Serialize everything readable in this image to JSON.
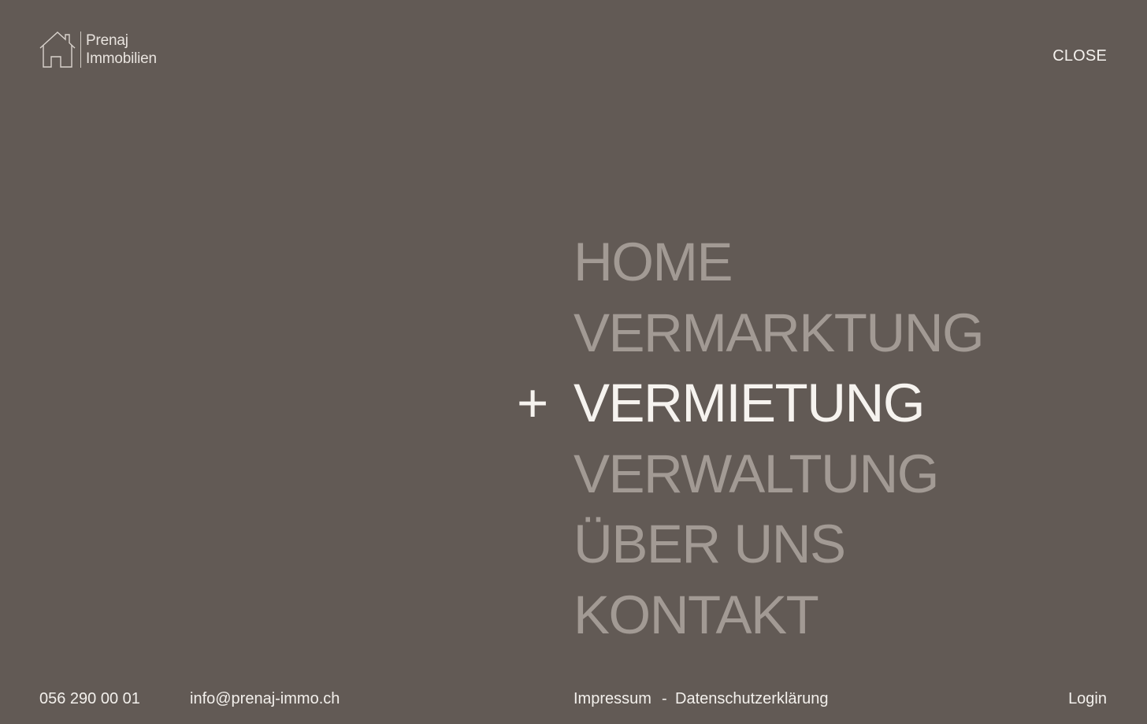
{
  "logo": {
    "line1": "Prenaj",
    "line2": "Immobilien",
    "icon": "house-icon"
  },
  "header": {
    "close_label": "CLOSE"
  },
  "menu": {
    "active_marker": "+",
    "items": [
      {
        "label": "HOME",
        "active": false
      },
      {
        "label": "VERMARKTUNG",
        "active": false
      },
      {
        "label": "VERMIETUNG",
        "active": true
      },
      {
        "label": "VERWALTUNG",
        "active": false
      },
      {
        "label": "ÜBER UNS",
        "active": false
      },
      {
        "label": "KONTAKT",
        "active": false
      }
    ]
  },
  "footer": {
    "phone": "056 290 00 01",
    "email": "info@prenaj-immo.ch",
    "impressum": "Impressum",
    "separator": "-",
    "privacy": "Datenschutzerklärung",
    "login": "Login"
  },
  "colors": {
    "background": "#625a55",
    "menu_inactive": "#a29a94",
    "menu_active": "#f6f3ef",
    "text": "#f3f0ec"
  }
}
